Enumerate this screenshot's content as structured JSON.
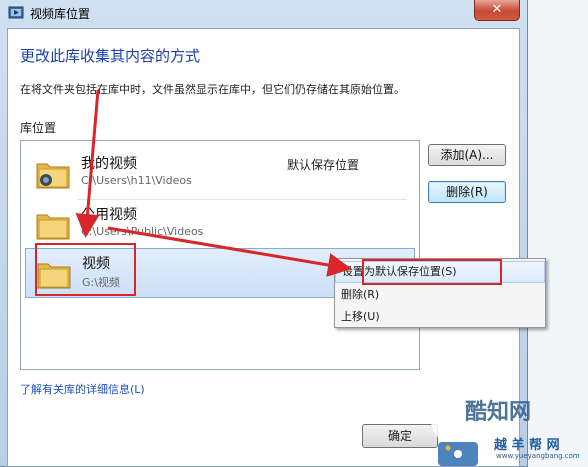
{
  "window": {
    "title": "视频库位置",
    "close_glyph": "✕"
  },
  "dialog": {
    "heading": "更改此库收集其内容的方式",
    "description": "在将文件夹包括在库中时，文件虽然显示在库中，但它们仍存储在其原始位置。",
    "locations_label": "库位置",
    "locations": [
      {
        "name": "我的视频",
        "path": "C:\\Users\\h11\\Videos",
        "badge": "默认保存位置",
        "icon": "video-folder-icon"
      },
      {
        "name": "公用视频",
        "path": "C:\\Users\\Public\\Videos",
        "badge": "",
        "icon": "folder-icon"
      },
      {
        "name": "视频",
        "path": "G:\\视频",
        "badge": "",
        "icon": "folder-icon"
      }
    ],
    "add_button": "添加(A)...",
    "remove_button": "删除(R)",
    "learn_more_link": "了解有关库的详细信息(L)",
    "ok_button": "确定"
  },
  "context_menu": {
    "items": [
      {
        "label": "设置为默认保存位置(S)"
      },
      {
        "label": "删除(R)"
      },
      {
        "label": "上移(U)"
      }
    ]
  },
  "watermark": {
    "line1": "酷知网",
    "line2": "越 羊 帮 网",
    "url": "www.yueyangbang.com"
  },
  "colors": {
    "annotation_red": "#d8262b",
    "heading_blue": "#1b3fa8",
    "selection": "#cce0f8"
  }
}
